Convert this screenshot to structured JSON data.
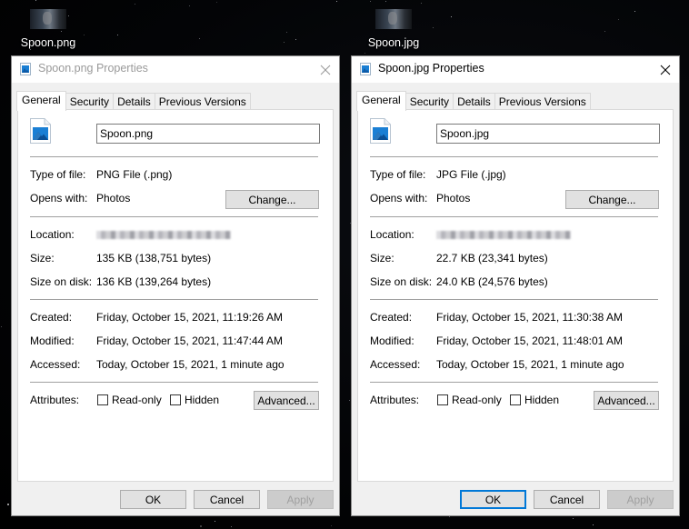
{
  "desktop": {
    "icons": [
      {
        "label": "Spoon.png"
      },
      {
        "label": "Spoon.jpg"
      }
    ]
  },
  "dialogs": [
    {
      "title": "Spoon.png Properties",
      "active": false,
      "tabs": [
        "General",
        "Security",
        "Details",
        "Previous Versions"
      ],
      "selected_tab": "General",
      "file_name": "Spoon.png",
      "labels": {
        "type": "Type of file:",
        "opens": "Opens with:",
        "location": "Location:",
        "size": "Size:",
        "size_on_disk": "Size on disk:",
        "created": "Created:",
        "modified": "Modified:",
        "accessed": "Accessed:",
        "attributes": "Attributes:"
      },
      "type_of_file": "PNG File (.png)",
      "opens_with": "Photos",
      "change_label": "Change...",
      "size": "135 KB (138,751 bytes)",
      "size_on_disk": "136 KB (139,264 bytes)",
      "created": "Friday, October 15, 2021, 11:19:26 AM",
      "modified": "Friday, October 15, 2021, 11:47:44 AM",
      "accessed": "Today, October 15, 2021, 1 minute ago",
      "attributes": {
        "read_only": "Read-only",
        "hidden": "Hidden",
        "read_only_checked": false,
        "hidden_checked": false
      },
      "advanced_label": "Advanced...",
      "buttons": {
        "ok": "OK",
        "cancel": "Cancel",
        "apply": "Apply"
      }
    },
    {
      "title": "Spoon.jpg Properties",
      "active": true,
      "tabs": [
        "General",
        "Security",
        "Details",
        "Previous Versions"
      ],
      "selected_tab": "General",
      "file_name": "Spoon.jpg",
      "labels": {
        "type": "Type of file:",
        "opens": "Opens with:",
        "location": "Location:",
        "size": "Size:",
        "size_on_disk": "Size on disk:",
        "created": "Created:",
        "modified": "Modified:",
        "accessed": "Accessed:",
        "attributes": "Attributes:"
      },
      "type_of_file": "JPG File (.jpg)",
      "opens_with": "Photos",
      "change_label": "Change...",
      "size": "22.7 KB (23,341 bytes)",
      "size_on_disk": "24.0 KB (24,576 bytes)",
      "created": "Friday, October 15, 2021, 11:30:38 AM",
      "modified": "Friday, October 15, 2021, 11:48:01 AM",
      "accessed": "Today, October 15, 2021, 1 minute ago",
      "attributes": {
        "read_only": "Read-only",
        "hidden": "Hidden",
        "read_only_checked": false,
        "hidden_checked": false
      },
      "advanced_label": "Advanced...",
      "buttons": {
        "ok": "OK",
        "cancel": "Cancel",
        "apply": "Apply"
      }
    }
  ],
  "colors": {
    "accent": "#0078d7",
    "file_icon_blue": "#1a7fd4"
  }
}
